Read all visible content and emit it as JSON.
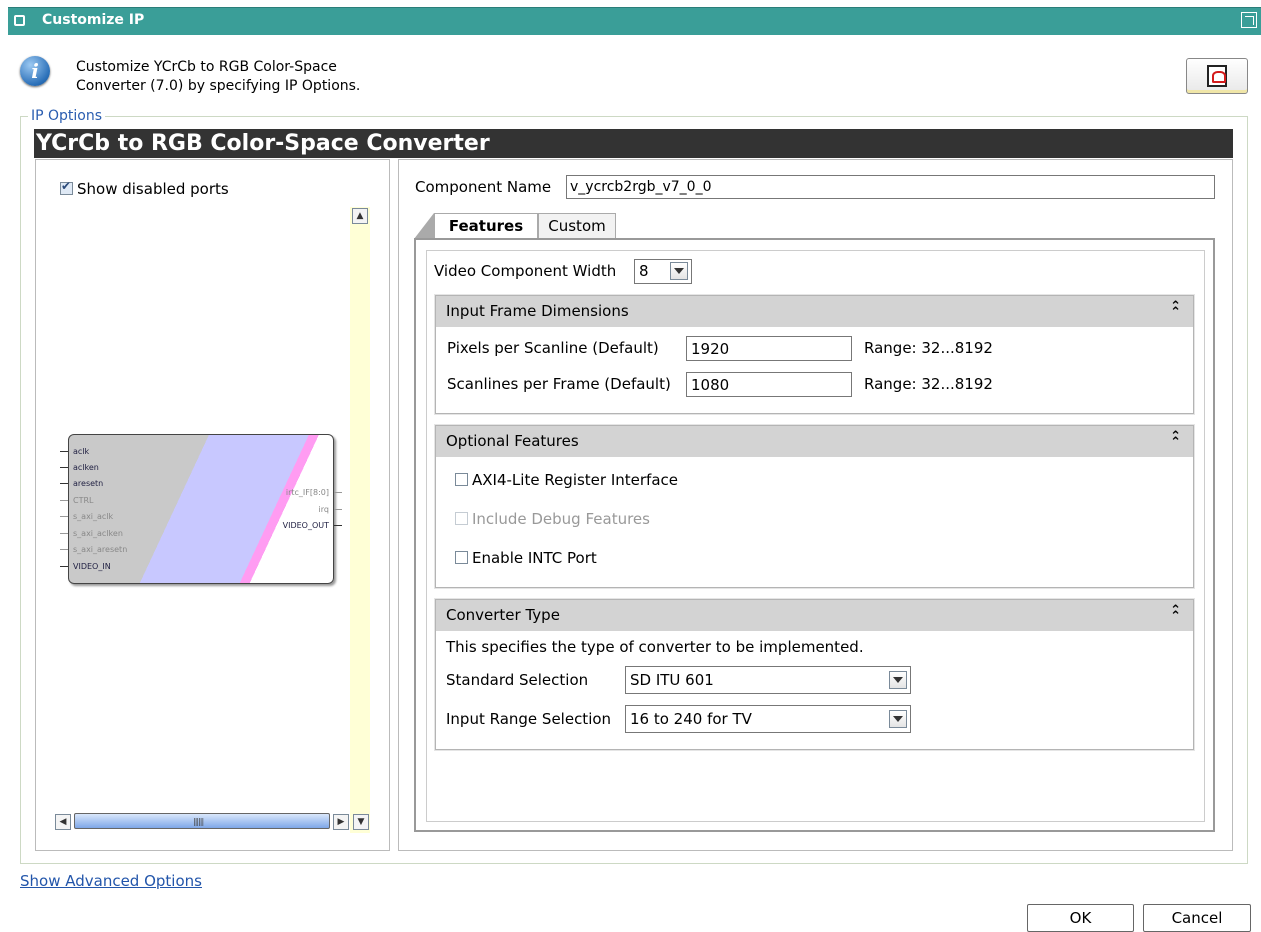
{
  "window": {
    "title": "Customize IP"
  },
  "header": {
    "description_line1": "Customize YCrCb to RGB Color-Space",
    "description_line2": "Converter (7.0) by specifying IP Options."
  },
  "ip_options": {
    "group_label": "IP Options",
    "banner": "YCrCb to RGB Color-Space Converter"
  },
  "left_panel": {
    "show_disabled_label": "Show disabled ports",
    "show_disabled_checked": true,
    "ports_left": [
      "aclk",
      "aclken",
      "aresetn",
      "CTRL",
      "s_axi_aclk",
      "s_axi_aclken",
      "s_axi_aresetn",
      "VIDEO_IN"
    ],
    "ports_right": [
      "irtc_IF[8:0]",
      "irq",
      "VIDEO_OUT"
    ]
  },
  "component": {
    "label": "Component Name",
    "value": "v_ycrcb2rgb_v7_0_0"
  },
  "tabs": [
    {
      "label": "Features",
      "active": true
    },
    {
      "label": "Custom",
      "active": false
    }
  ],
  "video_component_width": {
    "label": "Video Component Width",
    "value": "8"
  },
  "input_frame": {
    "title": "Input Frame Dimensions",
    "pixels_label": "Pixels per Scanline (Default)",
    "pixels_value": "1920",
    "pixels_range": "Range: 32...8192",
    "scanlines_label": "Scanlines per Frame (Default)",
    "scanlines_value": "1080",
    "scanlines_range": "Range: 32...8192"
  },
  "optional_features": {
    "title": "Optional Features",
    "items": [
      {
        "label": "AXI4-Lite Register Interface",
        "checked": false,
        "enabled": true
      },
      {
        "label": "Include Debug Features",
        "checked": false,
        "enabled": false
      },
      {
        "label": "Enable INTC Port",
        "checked": false,
        "enabled": true
      }
    ]
  },
  "converter_type": {
    "title": "Converter Type",
    "description": "This specifies the type of converter to be implemented.",
    "standard_label": "Standard Selection",
    "standard_value": "SD ITU 601",
    "range_label": "Input Range Selection",
    "range_value": "16 to 240 for TV"
  },
  "footer": {
    "advanced_link": "Show Advanced Options",
    "ok_label": "OK",
    "cancel_label": "Cancel"
  },
  "colors": {
    "titlebar": "#3a9e98",
    "banner": "#333333",
    "section_header": "#d3d3d3",
    "link": "#2255aa"
  }
}
